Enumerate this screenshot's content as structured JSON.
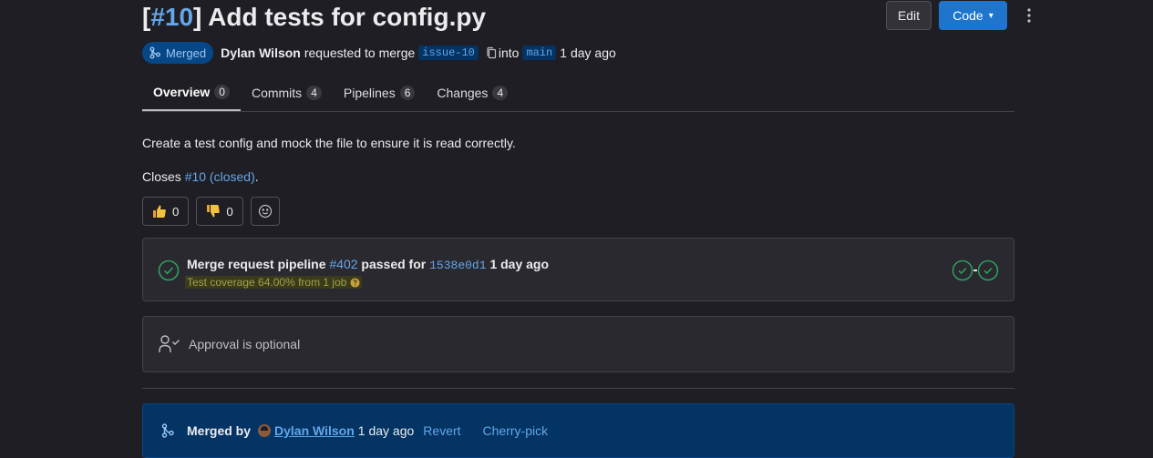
{
  "header": {
    "title_ref": "#10",
    "title_text": "Add tests for config.py",
    "edit_label": "Edit",
    "code_label": "Code"
  },
  "meta": {
    "status_badge": "Merged",
    "author": "Dylan Wilson",
    "requested_text": "requested to merge",
    "source_branch": "issue-10",
    "into_text": "into",
    "target_branch": "main",
    "time_ago": "1 day ago"
  },
  "tabs": [
    {
      "label": "Overview",
      "count": "0"
    },
    {
      "label": "Commits",
      "count": "4"
    },
    {
      "label": "Pipelines",
      "count": "6"
    },
    {
      "label": "Changes",
      "count": "4"
    }
  ],
  "description": {
    "text": "Create a test config and mock the file to ensure it is read correctly.",
    "closes_prefix": "Closes",
    "closes_link": "#10 (closed)",
    "closes_suffix": "."
  },
  "reactions": {
    "thumbs_up": "0",
    "thumbs_down": "0"
  },
  "pipeline": {
    "prefix": "Merge request pipeline",
    "id": "#402",
    "passed_for": "passed for",
    "sha": "1538e0d1",
    "time_ago": "1 day ago",
    "coverage": "Test coverage 64.00% from 1 job"
  },
  "approval": {
    "text": "Approval is optional"
  },
  "merged": {
    "label": "Merged by",
    "user": "Dylan Wilson",
    "time_ago": "1 day ago",
    "revert_label": "Revert",
    "cherry_pick_label": "Cherry-pick"
  },
  "colors": {
    "background": "#1f1e24",
    "link": "#63a6e9",
    "primary_button": "#1f75cb",
    "merged_badge": "#064787",
    "success": "#2da160"
  }
}
